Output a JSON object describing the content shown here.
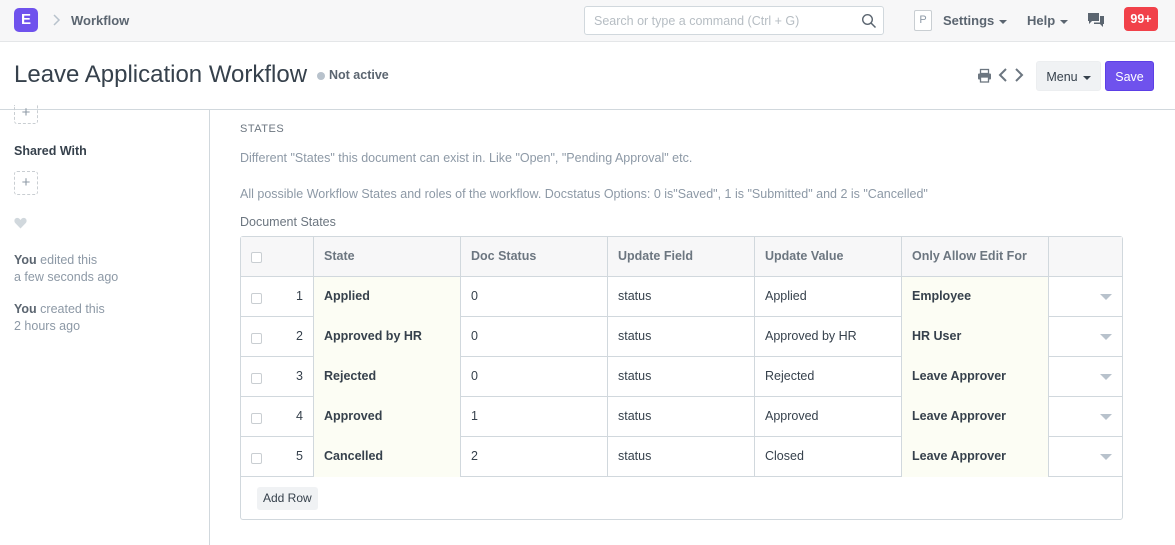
{
  "navbar": {
    "logo_letter": "E",
    "breadcrumb": "Workflow",
    "search_placeholder": "Search or type a command (Ctrl + G)",
    "avatar_letter": "P",
    "settings_label": "Settings",
    "help_label": "Help",
    "notifications_count": "99+"
  },
  "header": {
    "title": "Leave Application Workflow",
    "status": "Not active",
    "menu_label": "Menu",
    "save_label": "Save"
  },
  "sidebar": {
    "shared_with_label": "Shared With",
    "activity": [
      {
        "user": "You",
        "action": "edited this",
        "time": "a few seconds ago"
      },
      {
        "user": "You",
        "action": "created this",
        "time": "2 hours ago"
      }
    ]
  },
  "main": {
    "section_title": "STATES",
    "description": "Different \"States\" this document can exist in. Like \"Open\", \"Pending Approval\" etc.",
    "help_text": "All possible Workflow States and roles of the workflow. Docstatus Options: 0 is\"Saved\", 1 is \"Submitted\" and 2 is \"Cancelled\"",
    "table_label": "Document States",
    "columns": [
      "State",
      "Doc Status",
      "Update Field",
      "Update Value",
      "Only Allow Edit For"
    ],
    "rows": [
      {
        "idx": "1",
        "state": "Applied",
        "doc_status": "0",
        "update_field": "status",
        "update_value": "Applied",
        "role": "Employee"
      },
      {
        "idx": "2",
        "state": "Approved by HR",
        "doc_status": "0",
        "update_field": "status",
        "update_value": "Approved by HR",
        "role": "HR User"
      },
      {
        "idx": "3",
        "state": "Rejected",
        "doc_status": "0",
        "update_field": "status",
        "update_value": "Rejected",
        "role": "Leave Approver"
      },
      {
        "idx": "4",
        "state": "Approved",
        "doc_status": "1",
        "update_field": "status",
        "update_value": "Approved",
        "role": "Leave Approver"
      },
      {
        "idx": "5",
        "state": "Cancelled",
        "doc_status": "2",
        "update_field": "status",
        "update_value": "Closed",
        "role": "Leave Approver"
      }
    ],
    "add_row_label": "Add Row"
  },
  "colors": {
    "accent": "#6f52ed",
    "notification": "#f1414a",
    "row_highlight": "#fcfdf4"
  }
}
